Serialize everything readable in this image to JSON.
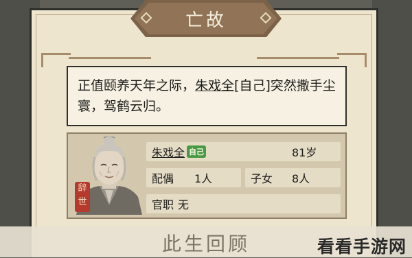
{
  "dialog": {
    "title": "亡故",
    "description": {
      "prefix": "正值颐养天年之际，",
      "name": "朱戏全",
      "suffix": "[自己]突然撒手尘寰，驾鹤云归。"
    }
  },
  "person": {
    "seal_text_1": "辞",
    "seal_text_2": "世",
    "name": "朱戏全",
    "self_badge": "自己",
    "age": "81岁",
    "spouse_label": "配偶",
    "spouse_value": "1人",
    "children_label": "子女",
    "children_value": "8人",
    "office_label": "官职",
    "office_value": "无"
  },
  "footer": {
    "section_title": "此生回顾"
  },
  "watermark": "看看手游网",
  "colors": {
    "title_plaque": "#917457",
    "panel_bg": "#eee5cf",
    "self_badge": "#4a9a44",
    "seal": "#b5392c"
  }
}
